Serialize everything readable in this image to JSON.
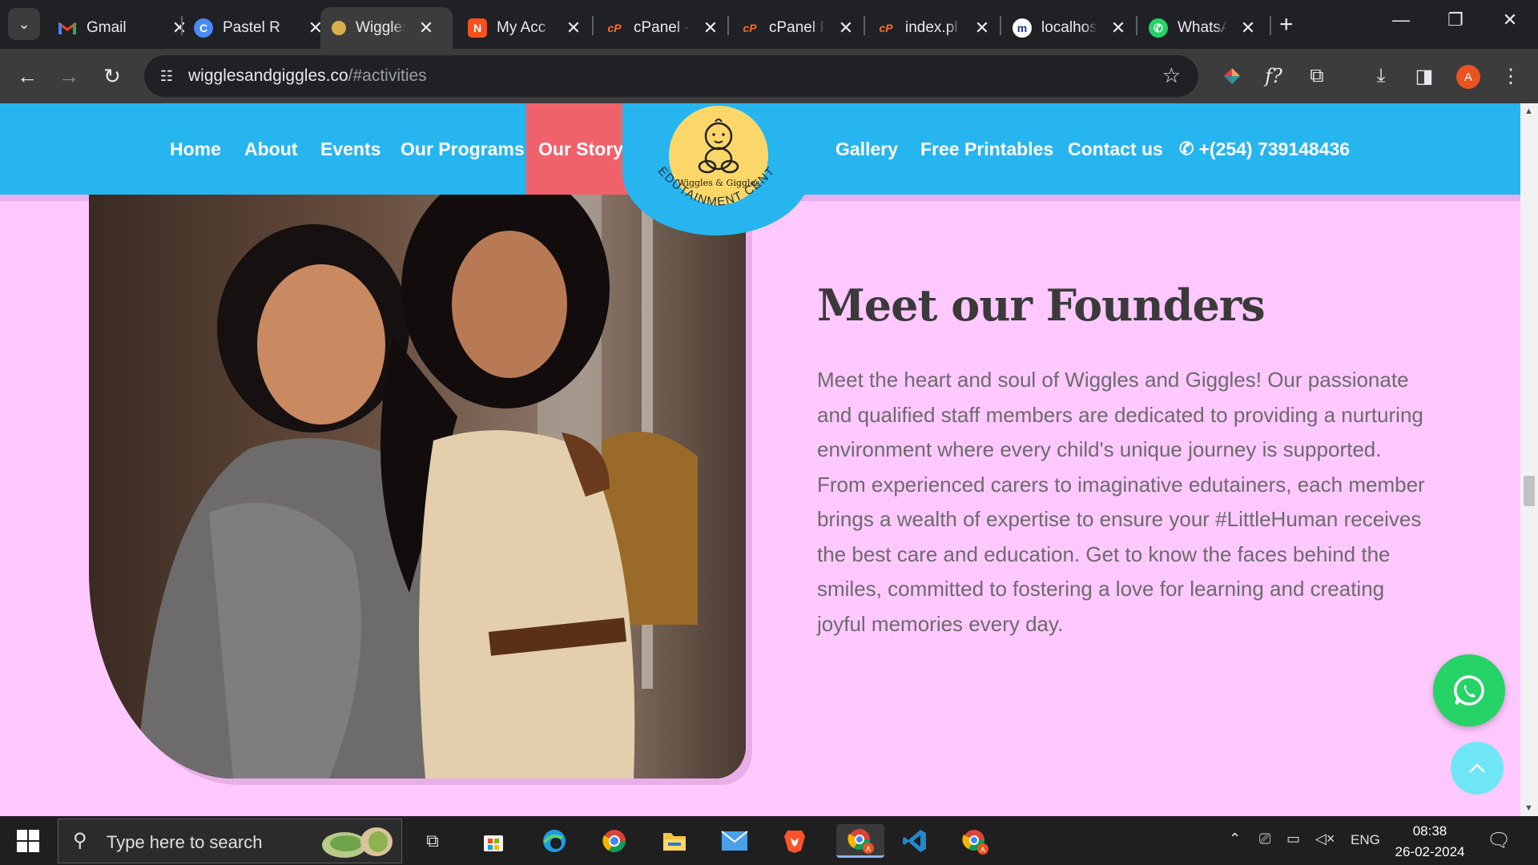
{
  "browser": {
    "tabs": [
      {
        "title": "Gmail",
        "icon": "gmail-icon"
      },
      {
        "title": "Pastel R",
        "icon": "pastel-icon"
      },
      {
        "title": "Wiggles",
        "icon": "wiggles-icon",
        "active": true
      },
      {
        "title": "My Acc",
        "icon": "myaccount-icon"
      },
      {
        "title": "cPanel -",
        "icon": "cpanel-icon"
      },
      {
        "title": "cPanel F",
        "icon": "cpanel-icon"
      },
      {
        "title": "index.pl",
        "icon": "cpanel-icon"
      },
      {
        "title": "localhos",
        "icon": "localhost-icon"
      },
      {
        "title": "WhatsA",
        "icon": "whatsapp-icon"
      }
    ],
    "url_host": "wigglesandgiggles.co",
    "url_path": "/#activities",
    "profile_initial": "A"
  },
  "nav": {
    "home": "Home",
    "about": "About",
    "events": "Events",
    "programs": "Our Programs",
    "story": "Our Story",
    "gallery": "Gallery",
    "printables": "Free Printables",
    "contact": "Contact us",
    "phone": "+(254) 739148436"
  },
  "logo": {
    "name": "Wiggles & Giggles",
    "subtitle": "EDUTAINMENT CENTRE"
  },
  "founders": {
    "heading": "Meet our Founders",
    "body": "Meet the heart and soul of Wiggles and Giggles! Our passionate and qualified staff members are dedicated to providing a nurturing environment where every child's unique journey is supported. From experienced carers to imaginative edutainers, each member brings a wealth of expertise to ensure your #LittleHuman receives the best care and education. Get to know the faces behind the smiles, committed to fostering a love for learning and creating joyful memories every day."
  },
  "taskbar": {
    "search_placeholder": "Type here to search",
    "language": "ENG",
    "time": "08:38",
    "date": "26-02-2024"
  },
  "colors": {
    "nav_bg": "#27b5ef",
    "nav_active": "#f0626b",
    "page_bg": "#ffc8ff",
    "whatsapp": "#25d366",
    "scroll_top": "#6ee6f5"
  }
}
